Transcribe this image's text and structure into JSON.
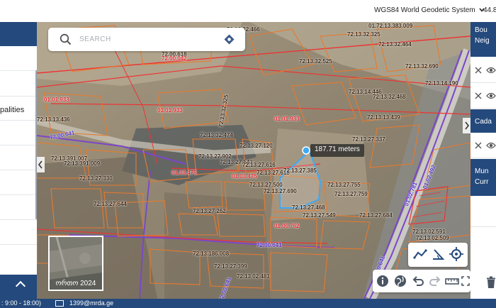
{
  "topbar": {
    "crs_label": "WGS84 World Geodetic System",
    "coord_partial": "44.8"
  },
  "left_panel": {
    "items": [
      {
        "label": ""
      },
      {
        "label": "palities"
      },
      {
        "label": ""
      },
      {
        "label": ""
      },
      {
        "label": ""
      },
      {
        "label": ""
      },
      {
        "label": ""
      }
    ]
  },
  "footer": {
    "hours": ": 9:00 - 18:00)",
    "email": "1399@mrda.ge"
  },
  "search": {
    "placeholder": "SEARCH"
  },
  "measurement": {
    "label": "187.71 meters"
  },
  "basemap": {
    "label": "ორთო 2024"
  },
  "right_panel": {
    "boundaries_title_1": "Bou",
    "boundaries_title_2": "Neig",
    "cadastral_title": "Cada",
    "municipal_title_1": "Mun",
    "municipal_title_2": "Curr"
  },
  "map_labels": [
    "72.13.32.466",
    "72.13.32.325",
    "01.72.13.383.009",
    "72.00.618",
    "72.00.042",
    "72.13.32.464",
    "72.13.32.525",
    "72.13.32.690",
    "72.13.14.446",
    "72.13.32.468",
    "72.13.13.439",
    "72.13.14.190",
    "01.01.933",
    "72.13.32.325",
    "01.01.933",
    "01.01.933",
    "72.13.32.474",
    "72.13.13.436",
    "72.13.27.337",
    "72.00.641",
    "72.13.27.120",
    "72.13.27.902",
    "72.13.27.543",
    "72.13.27.616",
    "72.13.27.618",
    "72.13.27.385",
    "72.13.391.007",
    "72.13.391.009",
    "01.03.475",
    "01.03.475",
    "01.02.781",
    "01.02.492",
    "72.13.27.330",
    "72.13.27.500",
    "72.13.27.690",
    "72.13.27.755",
    "72.13.27.759",
    "72.13.27.644",
    "72.13.27.468",
    "72.13.27.262",
    "72.13.27.684",
    "01.00.762",
    "72.00.641",
    "72.13.186.008",
    "72.13.27.549",
    "72.13.02.509",
    "72.13.02.591",
    "72.13.27.399",
    "72.13.02.481",
    "72.00.641",
    "01.00.641"
  ]
}
